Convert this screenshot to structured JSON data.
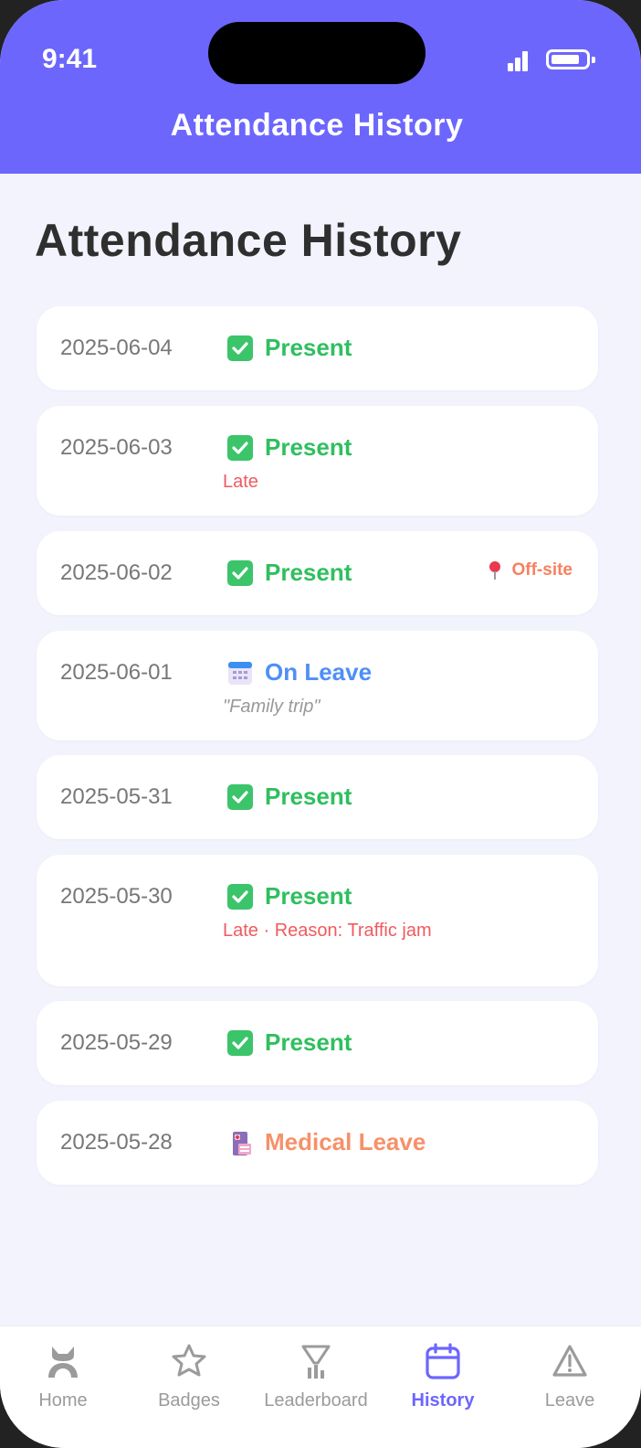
{
  "status_bar": {
    "time": "9:41"
  },
  "header": {
    "title": "Attendance History"
  },
  "page": {
    "title": "Attendance History"
  },
  "colors": {
    "accent": "#6c66fd",
    "present": "#2fbf5f",
    "leave": "#4f8ff6",
    "medical": "#f6916a",
    "late": "#f05a5f",
    "offsite": "#f6815e"
  },
  "records": [
    {
      "date": "2025-06-04",
      "status": "Present",
      "icon": "check-icon"
    },
    {
      "date": "2025-06-03",
      "status": "Present",
      "icon": "check-icon",
      "sub": "Late"
    },
    {
      "date": "2025-06-02",
      "status": "Present",
      "icon": "check-icon",
      "tag": "Off-site"
    },
    {
      "date": "2025-06-01",
      "status": "On Leave",
      "icon": "calendar-icon",
      "note": "\"Family trip\""
    },
    {
      "date": "2025-05-31",
      "status": "Present",
      "icon": "check-icon"
    },
    {
      "date": "2025-05-30",
      "status": "Present",
      "icon": "check-icon",
      "sub": "Late · Reason: Traffic jam"
    },
    {
      "date": "2025-05-29",
      "status": "Present",
      "icon": "check-icon"
    },
    {
      "date": "2025-05-28",
      "status": "Medical Leave",
      "icon": "hospital-icon"
    }
  ],
  "tabs": [
    {
      "label": "Home",
      "icon": "home-icon"
    },
    {
      "label": "Badges",
      "icon": "star-icon"
    },
    {
      "label": "Leaderboard",
      "icon": "trophy-icon"
    },
    {
      "label": "History",
      "icon": "calendar-icon",
      "active": true
    },
    {
      "label": "Leave",
      "icon": "warning-icon"
    }
  ]
}
